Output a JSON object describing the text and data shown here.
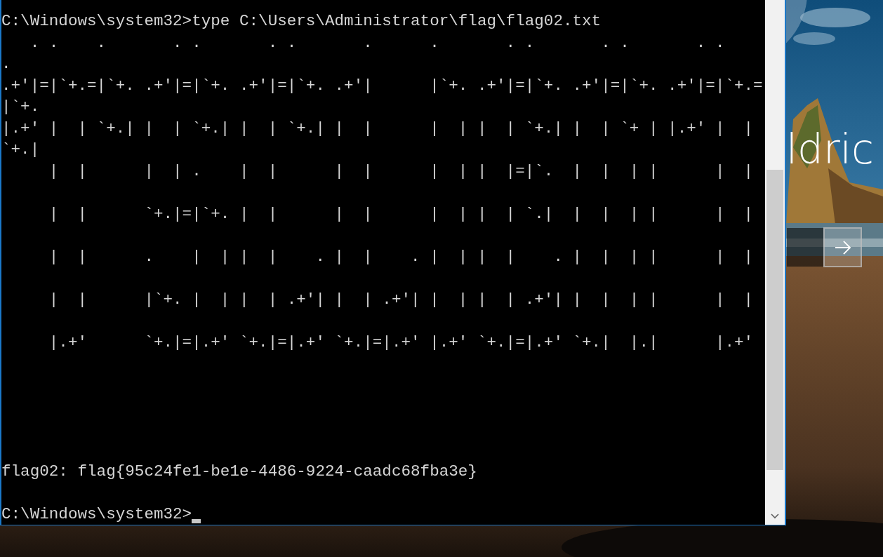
{
  "console": {
    "blocks": [
      [
        "C:\\Windows\\system32>type C:\\Users\\Administrator\\flag\\flag02.txt",
        "   . .    .       . .       . .       .      .       . .       . .       . .",
        ".",
        ".+'|=|`+.=|`+. .+'|=|`+. .+'|=|`+. .+'|      |`+. .+'|=|`+. .+'|=|`+. .+'|=|`+.=",
        "|`+.",
        "|.+' |  | `+.| |  | `+.| |  | `+.| |  |      |  | |  | `+.| |  | `+ | |.+' |  |",
        "`+.|",
        "     |  |      |  | .    |  |      |  |      |  | |  |=|`.  |  |  | |      |  |"
      ],
      [
        "     |  |      `+.|=|`+. |  |      |  |      |  | |  | `.|  |  |  | |      |  |"
      ],
      [
        "     |  |      .    |  | |  |    . |  |    . |  | |  |    . |  |  | |      |  |"
      ],
      [
        "     |  |      |`+. |  | |  | .+'| |  | .+'| |  | |  | .+'| |  |  | |      |  |"
      ],
      [
        "     |.+'      `+.|=|.+' `+.|=|.+' `+.|=|.+' |.+' `+.|=|.+' `+.|  |.|      |.+'"
      ]
    ],
    "result": "flag02: flag{95c24fe1-be1e-4486-9224-caadc68fba3e}",
    "prompt": "C:\\Windows\\system32>"
  },
  "lock_screen": {
    "user_name": "ldric"
  }
}
